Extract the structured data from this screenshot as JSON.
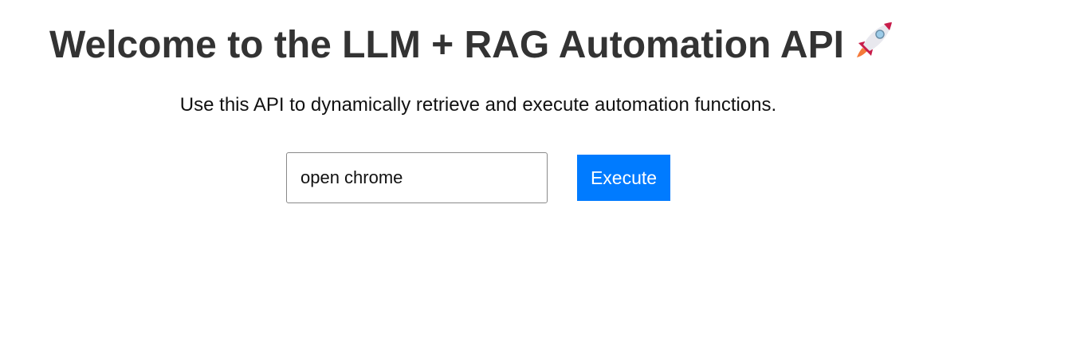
{
  "header": {
    "title": "Welcome to the LLM + RAG Automation API",
    "title_icon": "rocket-icon"
  },
  "main": {
    "subtitle": "Use this API to dynamically retrieve and execute automation functions.",
    "command_input": {
      "value": "open chrome"
    },
    "execute_button_label": "Execute"
  },
  "colors": {
    "button_background": "#007bff",
    "title_text": "#333333"
  }
}
